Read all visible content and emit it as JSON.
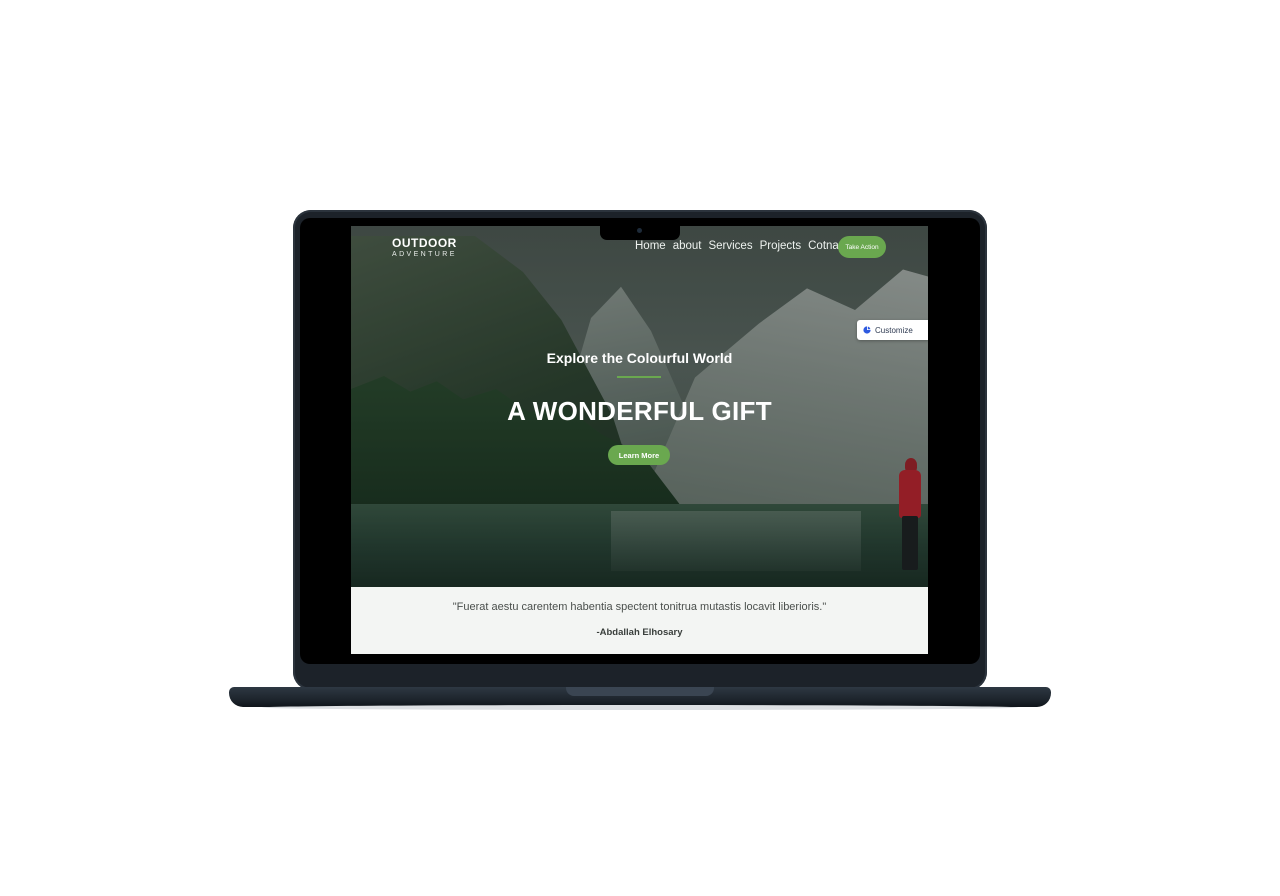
{
  "nav": {
    "brand_title": "OUTDOOR",
    "brand_subtitle": "ADVENTURE",
    "links": [
      "Home",
      "about",
      "Services",
      "Projects",
      "Cotnact"
    ],
    "cta": "Take Action"
  },
  "customize": {
    "label": "Customize",
    "icon": "customize-icon"
  },
  "hero": {
    "subtitle": "Explore the Colourful World",
    "title": "A WONDERFUL GIFT",
    "button": "Learn More"
  },
  "quote": {
    "text": "\"Fuerat aestu carentem habentia spectent tonitrua mutastis locavit liberioris.\"",
    "author": "-Abdallah Elhosary"
  },
  "colors": {
    "accent": "#6aa84f",
    "quote_background": "#f3f5f3",
    "laptop_frame": "#1c2229"
  }
}
